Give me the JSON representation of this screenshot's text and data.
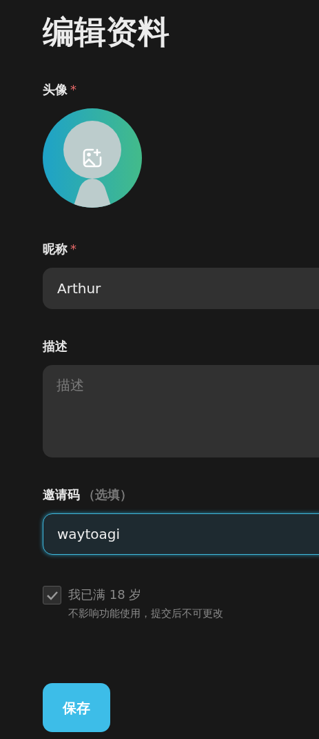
{
  "title": "编辑资料",
  "avatar": {
    "label": "头像",
    "mark": "*"
  },
  "fields": [
    {
      "kind": "input",
      "label": "昵称",
      "mark": "*",
      "value": "Arthur",
      "focused": false
    },
    {
      "kind": "textarea",
      "label": "描述",
      "placeholder": "描述"
    },
    {
      "kind": "input",
      "label": "邀请码",
      "hint": "（选填）",
      "value": "waytoagi",
      "focused": true
    }
  ],
  "age_check": {
    "label": "我已满 18 岁",
    "note": "不影响功能使用，提交后不可更改",
    "checked": true,
    "disabled": true
  },
  "save_button": "保存"
}
